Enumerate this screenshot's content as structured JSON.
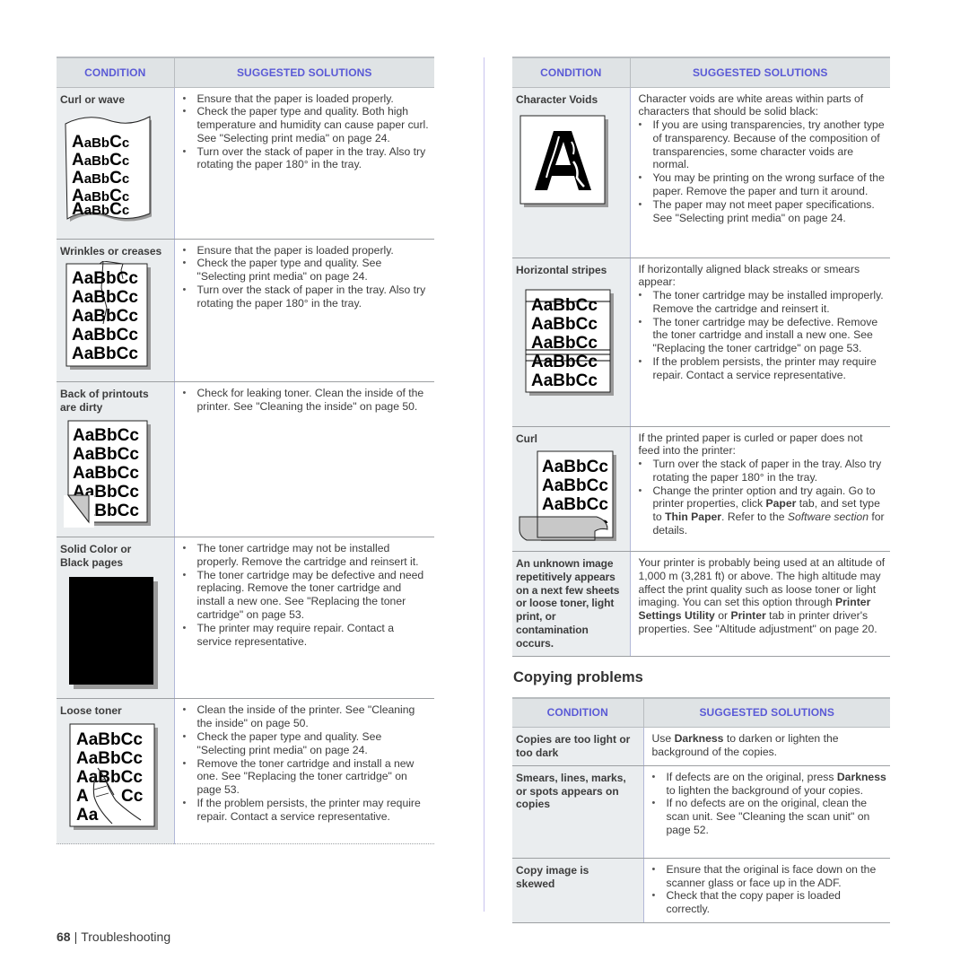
{
  "left_table": {
    "headers": {
      "condition": "CONDITION",
      "solutions": "SUGGESTED SOLUTIONS"
    },
    "rows": [
      {
        "condition": "Curl or wave",
        "illustration": "curled-paper-icon",
        "illustration_text": "AaBbCc",
        "bullets": [
          "Ensure that the paper is loaded properly.",
          "Check the paper type and quality. Both high temperature and humidity can cause paper curl. See \"Selecting print media\" on page 24.",
          "Turn over the stack of paper in the tray. Also try rotating the paper 180° in the tray."
        ]
      },
      {
        "condition": "Wrinkles or creases",
        "illustration": "wrinkled-paper-icon",
        "illustration_text": "AaBbCc",
        "bullets": [
          "Ensure that the paper is loaded properly.",
          "Check the paper type and quality. See \"Selecting print media\" on page 24.",
          "Turn over the stack of paper in the tray. Also try rotating the paper 180° in the tray."
        ]
      },
      {
        "condition": "Back of printouts are dirty",
        "illustration": "dirty-back-paper-icon",
        "illustration_text": "AaBbCc",
        "bullets": [
          "Check for leaking toner. Clean the inside of the printer. See \"Cleaning the inside\" on page 50."
        ]
      },
      {
        "condition": "Solid Color or Black pages",
        "illustration": "black-page-icon",
        "bullets": [
          "The toner cartridge may not be installed properly. Remove the cartridge and reinsert it.",
          "The toner cartridge may be defective and need replacing. Remove the toner cartridge and install a new one. See \"Replacing the toner cartridge\" on page 53.",
          "The printer may require repair. Contact a service representative."
        ]
      },
      {
        "condition": "Loose toner",
        "illustration": "smudged-paper-hand-icon",
        "illustration_text": "AaBbCc",
        "bullets": [
          "Clean the inside of the printer. See \"Cleaning the inside\" on page 50.",
          "Check the paper type and quality. See \"Selecting print media\" on page 24.",
          "Remove the toner cartridge and install a new one. See \"Replacing the toner cartridge\" on page 53.",
          "If the problem persists, the printer may require repair. Contact a service representative."
        ]
      }
    ]
  },
  "right_table": {
    "headers": {
      "condition": "CONDITION",
      "solutions": "SUGGESTED SOLUTIONS"
    },
    "rows": [
      {
        "condition": "Character Voids",
        "illustration": "character-void-icon",
        "illustration_text": "A",
        "intro": "Character voids are white areas within parts of characters that should be solid black:",
        "bullets": [
          "If you are using transparencies, try another type of transparency. Because of the composition of transparencies, some character voids are normal.",
          "You may be printing on the wrong surface of the paper. Remove the paper and turn it around.",
          "The paper may not meet paper specifications. See \"Selecting print media\" on page 24."
        ]
      },
      {
        "condition": "Horizontal stripes",
        "illustration": "striped-paper-icon",
        "illustration_text": "AaBbCc",
        "intro": "If horizontally aligned black streaks or smears appear:",
        "bullets": [
          "The toner cartridge may be installed improperly. Remove the cartridge and reinsert it.",
          "The toner cartridge may be defective. Remove the toner cartridge and install a new one. See \"Replacing the toner cartridge\" on page 53.",
          "If the problem persists, the printer may require repair. Contact a service representative."
        ]
      },
      {
        "condition": "Curl",
        "illustration": "curled-corner-paper-icon",
        "illustration_text": "AaBbCc",
        "intro": "If the printed paper is curled or paper does not feed into the printer:",
        "bullets": [
          "Turn over the stack of paper in the tray. Also try rotating the paper 180° in the tray.",
          {
            "parts": [
              {
                "t": "Change the printer option and try again. Go to printer properties, click "
              },
              {
                "t": "Paper",
                "b": true
              },
              {
                "t": " tab, and set type to "
              },
              {
                "t": "Thin Paper",
                "b": true
              },
              {
                "t": ". Refer to the "
              },
              {
                "t": "Software section",
                "i": true
              },
              {
                "t": " for details."
              }
            ]
          }
        ]
      },
      {
        "condition": "An unknown image repetitively appears on a next few sheets or loose toner, light print, or contamination occurs.",
        "paragraph": [
          {
            "t": "Your printer is probably being used at an altitude of 1,000 m (3,281 ft) or above. The high altitude may affect the print quality such as loose toner or light imaging. You can set this option through "
          },
          {
            "t": "Printer Settings Utility",
            "b": true
          },
          {
            "t": " or "
          },
          {
            "t": "Printer",
            "b": true
          },
          {
            "t": " tab in printer driver's properties. See \"Altitude adjustment\" on page 20."
          }
        ]
      }
    ]
  },
  "copying": {
    "title": "Copying problems",
    "headers": {
      "condition": "CONDITION",
      "solutions": "SUGGESTED SOLUTIONS"
    },
    "rows": [
      {
        "condition": "Copies are too light or too dark",
        "paragraph": [
          {
            "t": "Use "
          },
          {
            "t": "Darkness",
            "b": true
          },
          {
            "t": " to darken or lighten the background of the copies."
          }
        ]
      },
      {
        "condition": "Smears, lines, marks, or spots appears on copies",
        "bullets": [
          {
            "parts": [
              {
                "t": "If defects are on the original, press "
              },
              {
                "t": "Darkness",
                "b": true
              },
              {
                "t": " to lighten the background of your copies."
              }
            ]
          },
          "If no defects are on the original, clean the scan unit. See \"Cleaning the scan unit\" on page 52."
        ]
      },
      {
        "condition": "Copy image is skewed",
        "bullets": [
          "Ensure that the original is face down on the scanner glass or face up in the ADF.",
          "Check that the copy paper is loaded correctly."
        ]
      }
    ]
  },
  "footer": {
    "page_number": "68",
    "separator": "|",
    "section": "Troubleshooting"
  },
  "colors": {
    "header_text": "#5a5ad6",
    "header_bg": "#dfe3e5",
    "condition_bg": "#eaedef",
    "column_divider": "#c9c3ee"
  }
}
